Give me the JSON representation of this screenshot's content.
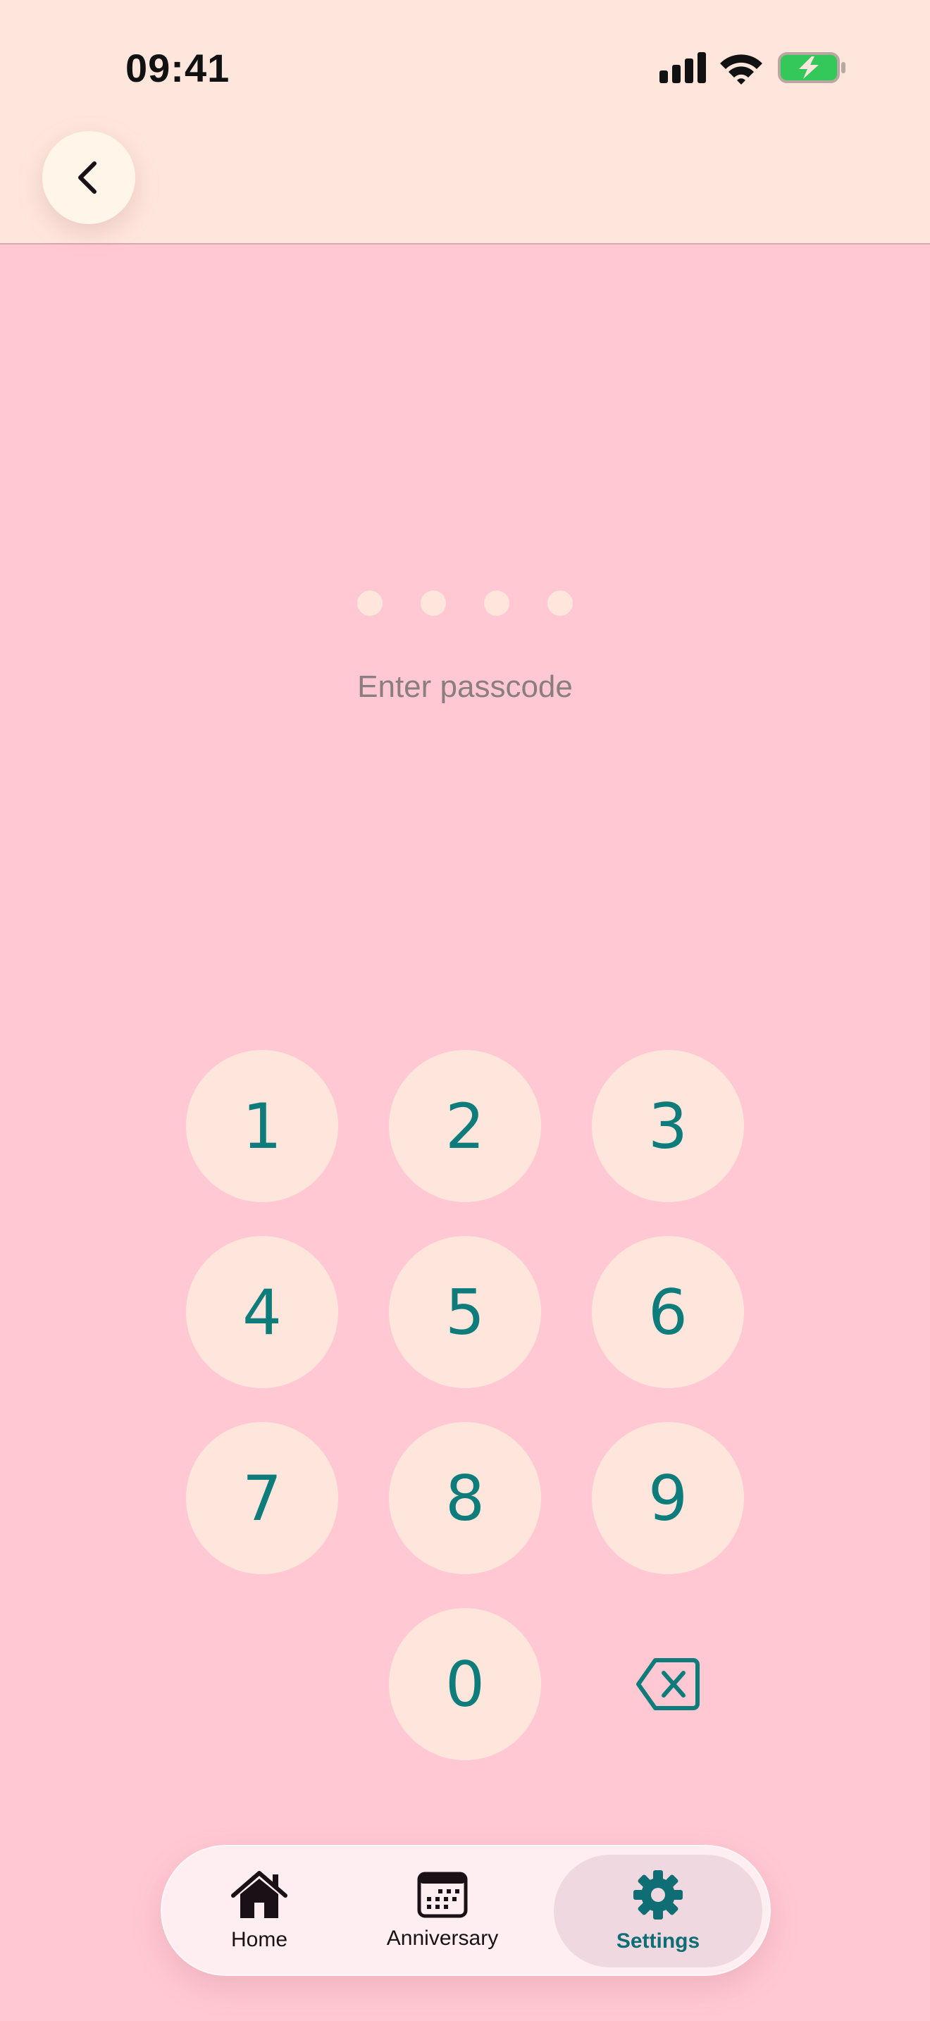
{
  "status_bar": {
    "time": "09:41"
  },
  "header": {
    "back_icon": "chevron-left-icon"
  },
  "passcode": {
    "dot_count": 4,
    "prompt": "Enter passcode"
  },
  "keypad": {
    "keys": [
      "1",
      "2",
      "3",
      "4",
      "5",
      "6",
      "7",
      "8",
      "9",
      "0"
    ],
    "delete_icon": "backspace-icon"
  },
  "tabbar": {
    "tabs": [
      {
        "label": "Home",
        "icon": "home-icon"
      },
      {
        "label": "Anniversary",
        "icon": "calendar-icon"
      },
      {
        "label": "Settings",
        "icon": "gear-icon"
      }
    ],
    "active": "Settings"
  },
  "colors": {
    "header_bg": "#FFE6DD",
    "screen_bg": "#FFC8D3",
    "key_bg": "#FFE6DD",
    "key_text": "#0E7C7B",
    "active_tab": "#0E6E73",
    "battery_green": "#34C759"
  }
}
